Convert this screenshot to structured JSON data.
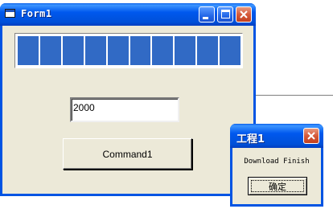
{
  "form1": {
    "title": "Form1",
    "progress": {
      "segments_filled": 10,
      "segments_total": 10,
      "fill_color": "#316ac5"
    },
    "textbox_value": "2000",
    "command_button_label": "Command1"
  },
  "msgbox": {
    "title": "工程1",
    "message": "Download Finish",
    "ok_label": "确定"
  },
  "colors": {
    "titlebar": "#0054e3",
    "window_face": "#ece9d8",
    "close_button": "#d65a3a"
  }
}
